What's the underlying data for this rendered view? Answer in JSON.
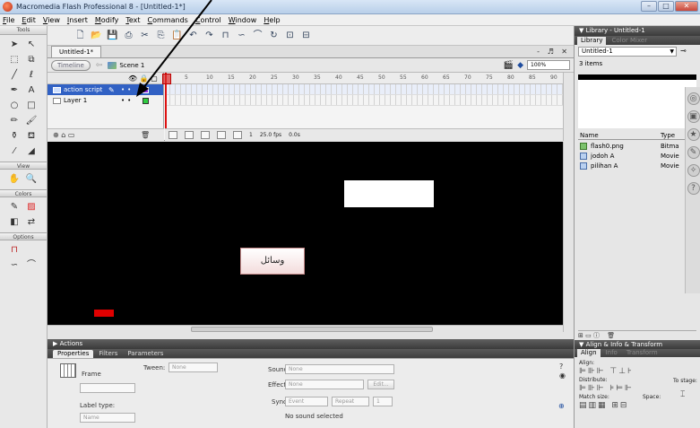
{
  "window": {
    "title": "Macromedia Flash Professional 8 - [Untitled-1*]",
    "controls": [
      "–",
      "□",
      "✕"
    ]
  },
  "menu": [
    "File",
    "Edit",
    "View",
    "Insert",
    "Modify",
    "Text",
    "Commands",
    "Control",
    "Window",
    "Help"
  ],
  "tools": {
    "header": "Tools",
    "view_label": "View",
    "colors_label": "Colors",
    "options_label": "Options"
  },
  "document": {
    "tab": "Untitled-1*",
    "window_controls": "- ♬ ✕",
    "timeline_button": "Timeline",
    "scene": "Scene 1",
    "zoom": "100%"
  },
  "timeline": {
    "layers": [
      {
        "name": "action script",
        "selected": true
      },
      {
        "name": "Layer 1",
        "selected": false
      }
    ],
    "ruler": [
      "5",
      "10",
      "15",
      "20",
      "25",
      "30",
      "35",
      "40",
      "45",
      "50",
      "55",
      "60",
      "65",
      "70",
      "75",
      "80",
      "85",
      "90"
    ],
    "current_frame": "1",
    "fps": "25.0 fps",
    "time": "0.0s"
  },
  "stage": {
    "button_text": "وسائل"
  },
  "panels": {
    "actions": "Actions",
    "property_tabs": [
      "Properties",
      "Filters",
      "Parameters"
    ],
    "frame_label": "Frame",
    "tween_label": "Tween:",
    "tween_value": "None",
    "label_type": "Label type:",
    "label_type_value": "Name",
    "sound_label": "Sound:",
    "sound_value": "None",
    "effect_label": "Effect:",
    "effect_value": "None",
    "edit_button": "Edit...",
    "sync_label": "Sync:",
    "sync_value": "Event",
    "repeat_value": "Repeat",
    "repeat_count": "1",
    "no_sound": "No sound selected"
  },
  "library": {
    "header": "▼ Library - Untitled-1",
    "tabs": [
      "Library",
      "Color Mixer"
    ],
    "doc": "Untitled-1",
    "count": "3 items",
    "col_name": "Name",
    "col_type": "Type",
    "items": [
      {
        "name": "flash0.png",
        "type": "Bitma"
      },
      {
        "name": "jodoh A",
        "type": "Movie"
      },
      {
        "name": "pilihan A",
        "type": "Movie"
      }
    ]
  },
  "align": {
    "header": "▼ Align & Info & Transform",
    "tabs": [
      "Align",
      "Info",
      "Transform"
    ],
    "align_label": "Align:",
    "distribute_label": "Distribute:",
    "match_label": "Match size:",
    "space_label": "Space:",
    "to_stage": "To stage:"
  }
}
